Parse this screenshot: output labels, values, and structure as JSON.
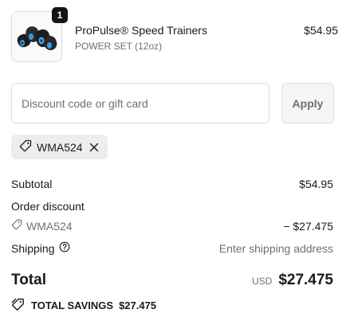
{
  "product": {
    "quantity": "1",
    "name": "ProPulse® Speed Trainers",
    "variant": "POWER SET (12oz)",
    "price": "$54.95",
    "image_icon": "speed-trainer-weights"
  },
  "discount": {
    "placeholder": "Discount code or gift card",
    "value": "",
    "apply_label": "Apply",
    "applied_code": "WMA524"
  },
  "summary": {
    "subtotal_label": "Subtotal",
    "subtotal_value": "$54.95",
    "order_discount_label": "Order discount",
    "discount_code": "WMA524",
    "discount_value": "− $27.475",
    "shipping_label": "Shipping",
    "shipping_value": "Enter shipping address"
  },
  "total": {
    "label": "Total",
    "currency": "USD",
    "amount": "$27.475"
  },
  "savings": {
    "label": "TOTAL SAVINGS",
    "amount": "$27.475"
  },
  "colors": {
    "text": "#1a1a1a",
    "muted": "#707070",
    "border": "#dedede",
    "chip_bg": "#ededed",
    "badge_bg": "#141414"
  }
}
